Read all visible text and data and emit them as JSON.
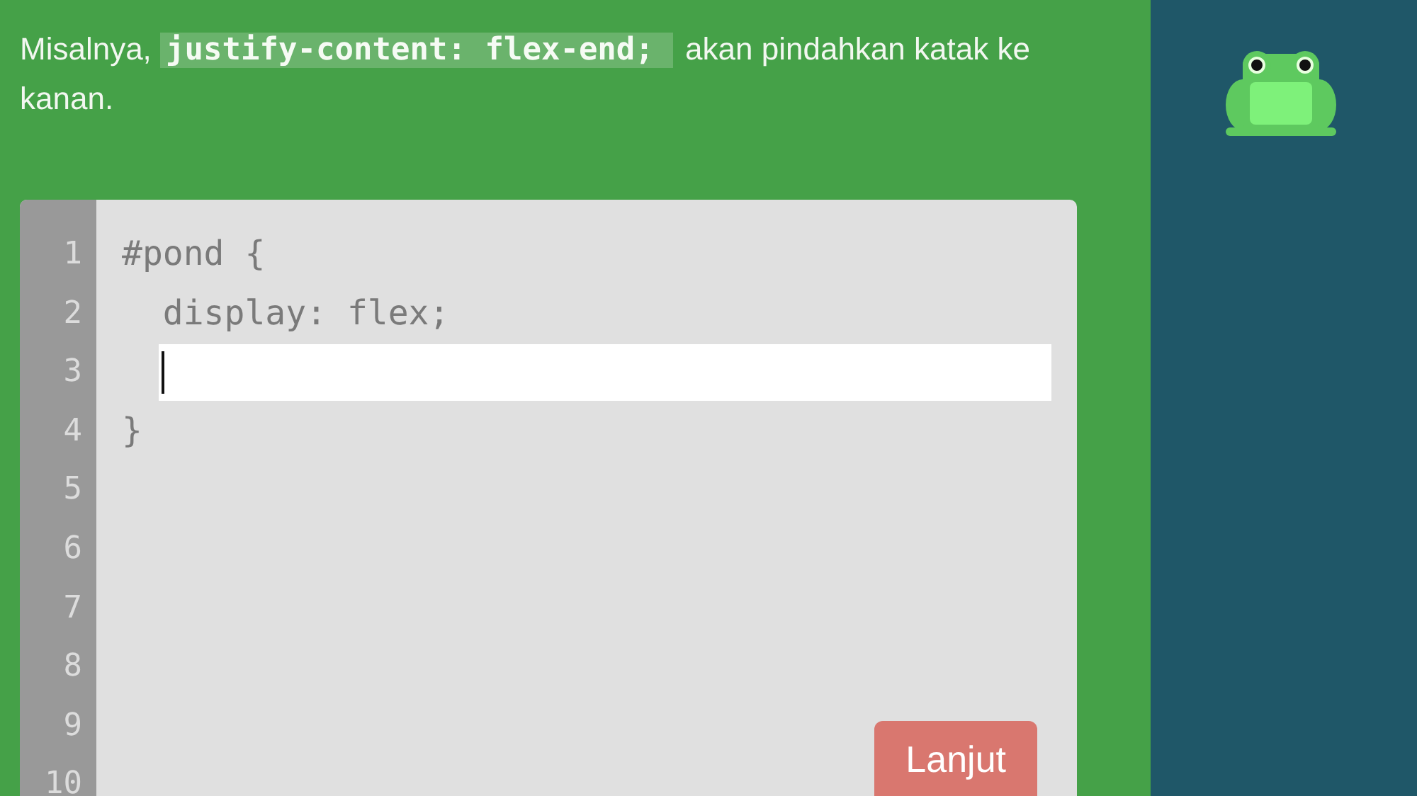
{
  "instruction": {
    "before": "Misalnya,",
    "code": "justify-content: flex-end;",
    "after": "akan pindahkan katak ke kanan."
  },
  "editor": {
    "line_numbers": [
      "1",
      "2",
      "3",
      "4",
      "5",
      "6",
      "7",
      "8",
      "9",
      "10"
    ],
    "lines": [
      {
        "kind": "code",
        "text": "#pond {"
      },
      {
        "kind": "code",
        "text": "  display: flex;"
      },
      {
        "kind": "input"
      },
      {
        "kind": "code",
        "text": "}"
      }
    ],
    "next_button": "Lanjut"
  }
}
